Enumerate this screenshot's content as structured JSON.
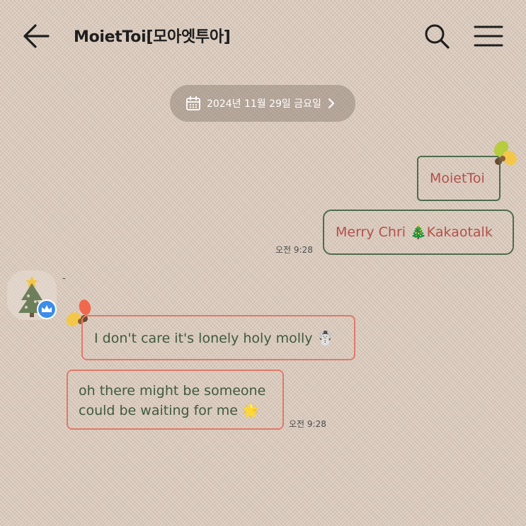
{
  "header": {
    "title": "MoietToi[모아엣투아]",
    "back_icon": "arrow-left-icon",
    "search_icon": "search-icon",
    "menu_icon": "hamburger-menu-icon"
  },
  "date_divider": {
    "text": "2024년 11월 29일 금요일",
    "calendar_icon": "calendar-icon",
    "chevron_icon": "chevron-right-icon"
  },
  "messages": [
    {
      "side": "right",
      "text": "MoietToi"
    },
    {
      "side": "right",
      "text": "Merry Chri 🎄Kakaotalk",
      "time": "오전 9:28"
    },
    {
      "side": "left",
      "text": "I don't care it's lonely holy molly ☃️"
    },
    {
      "side": "left",
      "line1": "oh there might be someone",
      "line2": "could be waiting for me 🌟",
      "time": "오전 9:28"
    }
  ],
  "sender": {
    "name": "-",
    "avatar_icon": "christmas-tree-avatar",
    "badge_icon": "crown-icon"
  },
  "colors": {
    "background": "#dccbbd",
    "bubble_green_border": "#4f6b4c",
    "bubble_green_text": "#b4504a",
    "bubble_red_border": "#e07a68",
    "bubble_red_text": "#3f5a3c",
    "badge_blue": "#3d8de8"
  }
}
